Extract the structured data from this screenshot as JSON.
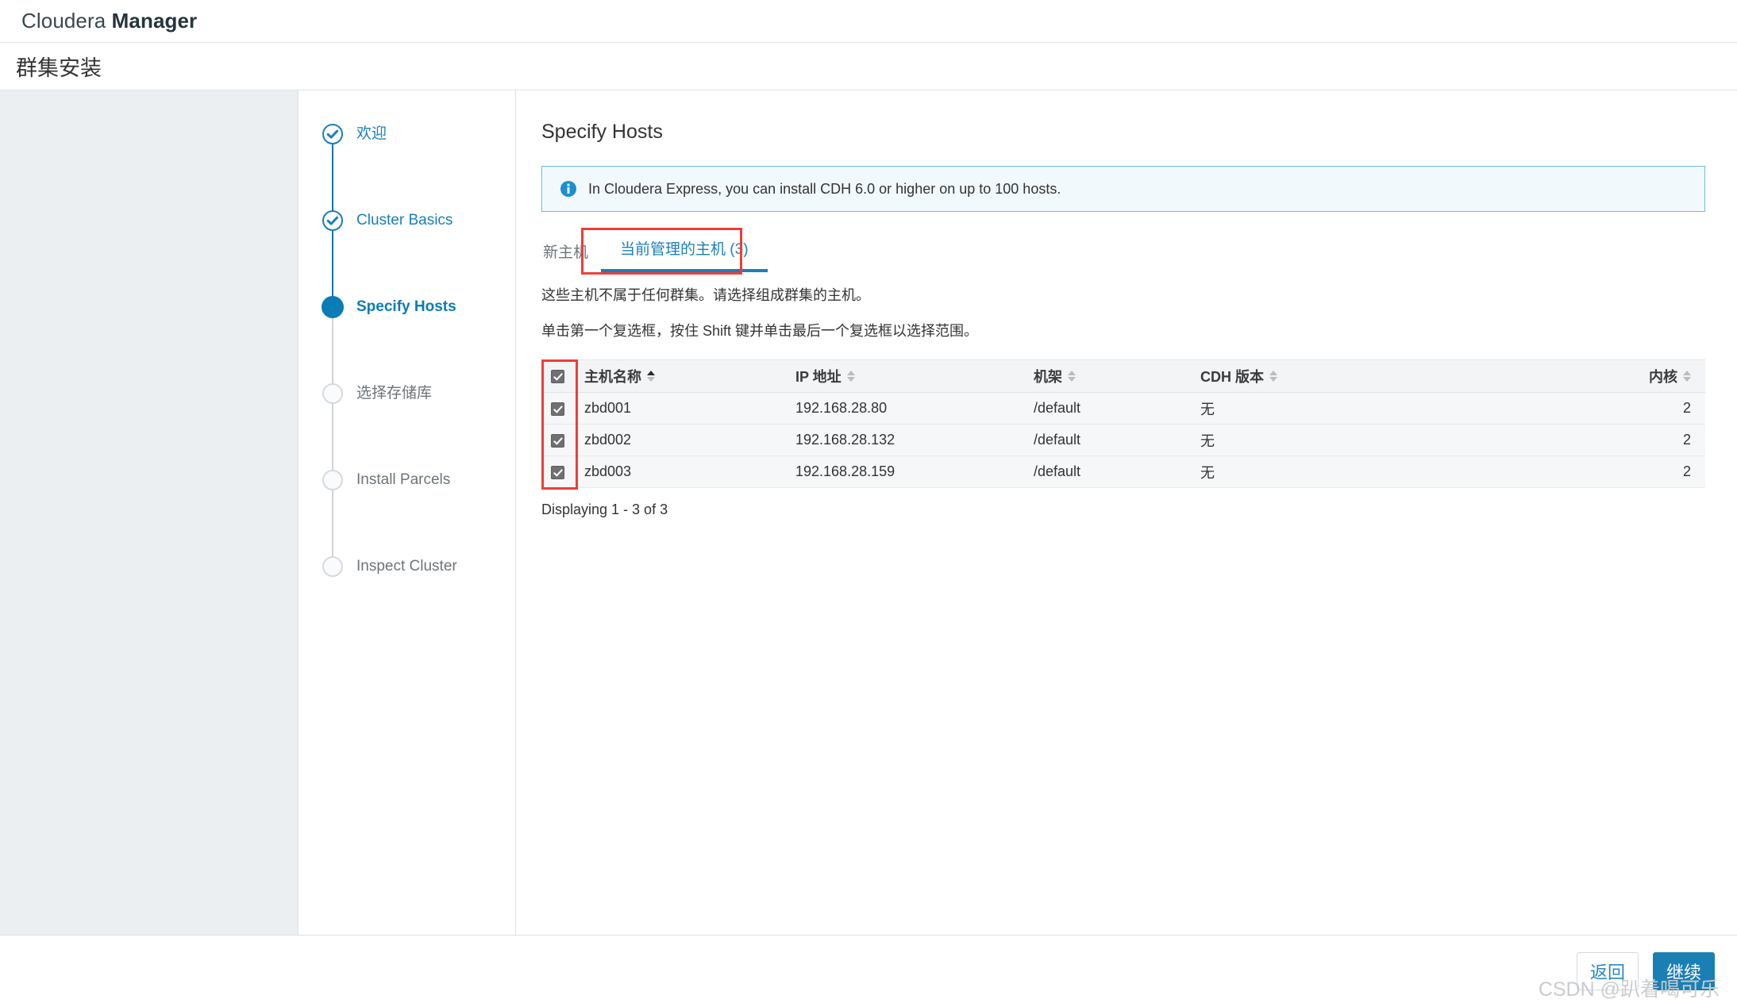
{
  "topbar": {
    "brand_light": "Cloudera ",
    "brand_bold": "Manager"
  },
  "page": {
    "title": "群集安装"
  },
  "wizard": {
    "steps": [
      {
        "label": "欢迎",
        "state": "done"
      },
      {
        "label": "Cluster Basics",
        "state": "done"
      },
      {
        "label": "Specify Hosts",
        "state": "current"
      },
      {
        "label": "选择存储库",
        "state": "todo"
      },
      {
        "label": "Install Parcels",
        "state": "todo"
      },
      {
        "label": "Inspect Cluster",
        "state": "todo"
      }
    ]
  },
  "content": {
    "heading": "Specify Hosts",
    "info_banner": {
      "icon": "info-icon",
      "text": "In Cloudera Express, you can install CDH 6.0 or higher on up to 100 hosts."
    },
    "tabs": [
      {
        "label": "新主机",
        "active": false
      },
      {
        "label": "当前管理的主机 (3)",
        "active": true
      }
    ],
    "description_1": "这些主机不属于任何群集。请选择组成群集的主机。",
    "description_2": "单击第一个复选框，按住 Shift 键并单击最后一个复选框以选择范围。",
    "table": {
      "columns": [
        {
          "label": "",
          "sort": "none",
          "key": "check"
        },
        {
          "label": "主机名称",
          "sort": "asc",
          "key": "hostname"
        },
        {
          "label": "IP 地址",
          "sort": "both",
          "key": "ip"
        },
        {
          "label": "机架",
          "sort": "both",
          "key": "rack"
        },
        {
          "label": "CDH 版本",
          "sort": "both",
          "key": "cdh"
        },
        {
          "label": "内核",
          "sort": "both",
          "key": "cores"
        }
      ],
      "header_checked": true,
      "rows": [
        {
          "checked": true,
          "hostname": "zbd001",
          "ip": "192.168.28.80",
          "rack": "/default",
          "cdh": "无",
          "cores": "2"
        },
        {
          "checked": true,
          "hostname": "zbd002",
          "ip": "192.168.28.132",
          "rack": "/default",
          "cdh": "无",
          "cores": "2"
        },
        {
          "checked": true,
          "hostname": "zbd003",
          "ip": "192.168.28.159",
          "rack": "/default",
          "cdh": "无",
          "cores": "2"
        }
      ]
    },
    "displaying": "Displaying 1 - 3 of 3"
  },
  "footer": {
    "back_label": "返回",
    "continue_label": "继续"
  },
  "watermark": "CSDN @趴着喝可乐",
  "colors": {
    "accent_blue": "#1b80b8",
    "button_blue": "#1b7fb4",
    "annotation_red": "#ef3e36",
    "info_bg": "#f2f9fd",
    "info_border": "#72b9dd"
  }
}
